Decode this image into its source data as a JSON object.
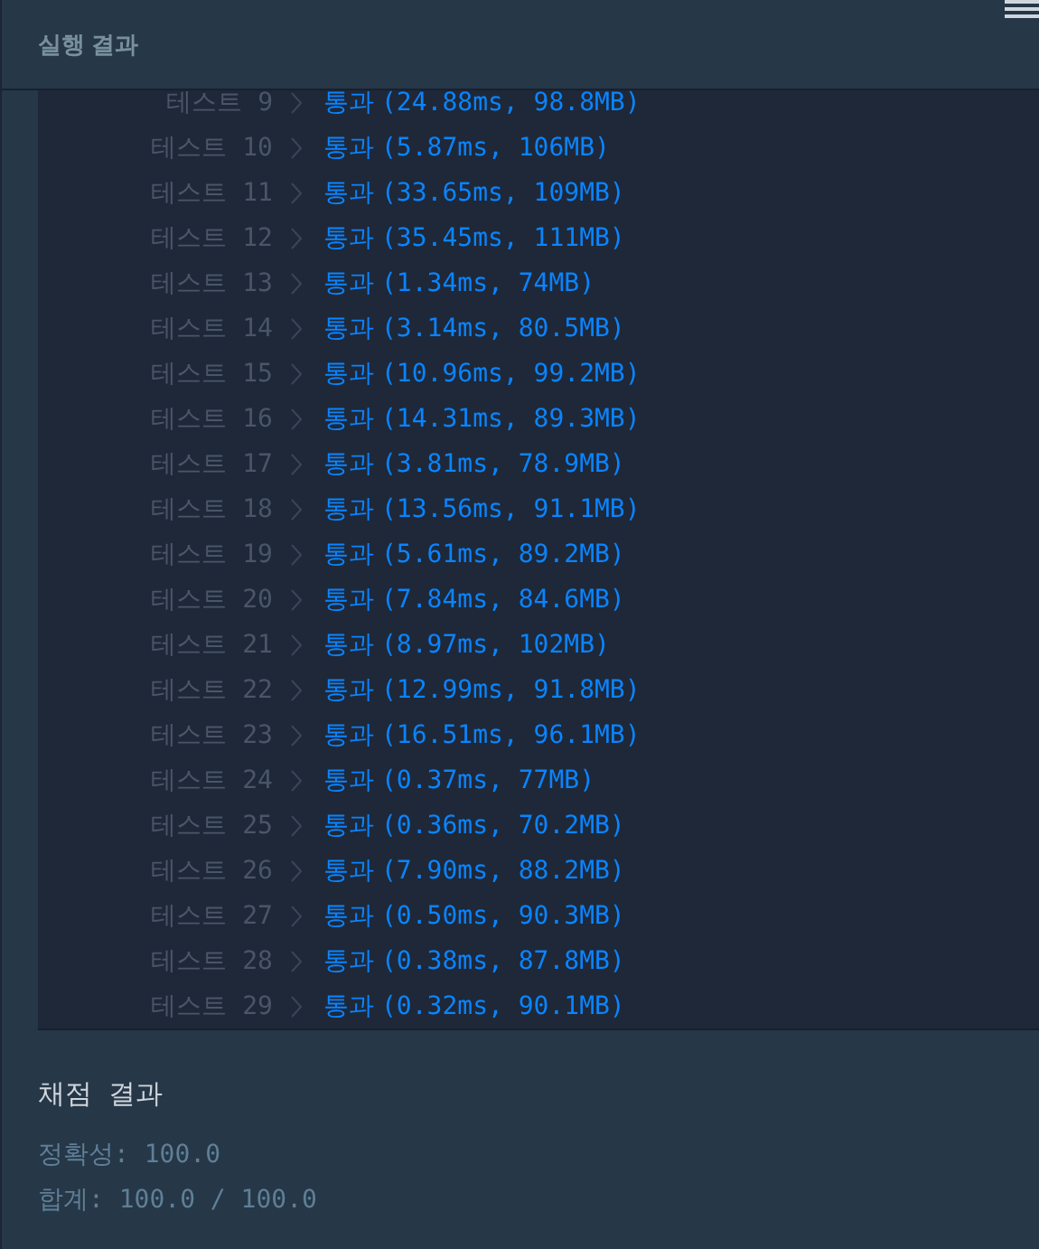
{
  "header": {
    "title": "실행 결과"
  },
  "tests": [
    {
      "label": "테스트 9",
      "status": "통과",
      "detail": "(24.88ms, 98.8MB)"
    },
    {
      "label": "테스트 10",
      "status": "통과",
      "detail": "(5.87ms, 106MB)"
    },
    {
      "label": "테스트 11",
      "status": "통과",
      "detail": "(33.65ms, 109MB)"
    },
    {
      "label": "테스트 12",
      "status": "통과",
      "detail": "(35.45ms, 111MB)"
    },
    {
      "label": "테스트 13",
      "status": "통과",
      "detail": "(1.34ms, 74MB)"
    },
    {
      "label": "테스트 14",
      "status": "통과",
      "detail": "(3.14ms, 80.5MB)"
    },
    {
      "label": "테스트 15",
      "status": "통과",
      "detail": "(10.96ms, 99.2MB)"
    },
    {
      "label": "테스트 16",
      "status": "통과",
      "detail": "(14.31ms, 89.3MB)"
    },
    {
      "label": "테스트 17",
      "status": "통과",
      "detail": "(3.81ms, 78.9MB)"
    },
    {
      "label": "테스트 18",
      "status": "통과",
      "detail": "(13.56ms, 91.1MB)"
    },
    {
      "label": "테스트 19",
      "status": "통과",
      "detail": "(5.61ms, 89.2MB)"
    },
    {
      "label": "테스트 20",
      "status": "통과",
      "detail": "(7.84ms, 84.6MB)"
    },
    {
      "label": "테스트 21",
      "status": "통과",
      "detail": "(8.97ms, 102MB)"
    },
    {
      "label": "테스트 22",
      "status": "통과",
      "detail": "(12.99ms, 91.8MB)"
    },
    {
      "label": "테스트 23",
      "status": "통과",
      "detail": "(16.51ms, 96.1MB)"
    },
    {
      "label": "테스트 24",
      "status": "통과",
      "detail": "(0.37ms, 77MB)"
    },
    {
      "label": "테스트 25",
      "status": "통과",
      "detail": "(0.36ms, 70.2MB)"
    },
    {
      "label": "테스트 26",
      "status": "통과",
      "detail": "(7.90ms, 88.2MB)"
    },
    {
      "label": "테스트 27",
      "status": "통과",
      "detail": "(0.50ms, 90.3MB)"
    },
    {
      "label": "테스트 28",
      "status": "통과",
      "detail": "(0.38ms, 87.8MB)"
    },
    {
      "label": "테스트 29",
      "status": "통과",
      "detail": "(0.32ms, 90.1MB)"
    }
  ],
  "grading": {
    "title": "채점 결과",
    "lines": [
      "정확성: 100.0",
      "합계: 100.0 / 100.0"
    ]
  }
}
